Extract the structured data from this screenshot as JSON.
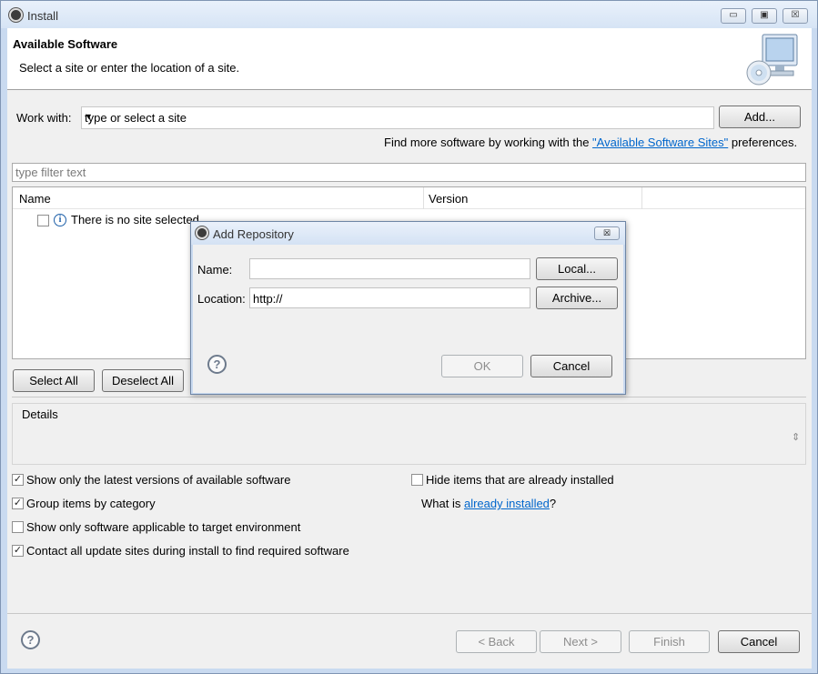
{
  "window": {
    "title": "Install"
  },
  "header": {
    "title": "Available Software",
    "description": "Select a site or enter the location of a site."
  },
  "work_with": {
    "label": "Work with:",
    "value": "type or select a site",
    "add_label": "Add..."
  },
  "more_software": {
    "prefix": "Find more software by working with the ",
    "link": "\"Available Software Sites\"",
    "suffix": " preferences."
  },
  "filter": {
    "placeholder": "type filter text"
  },
  "table": {
    "columns": [
      "Name",
      "Version"
    ],
    "rows": [
      {
        "label": "There is no site selected."
      }
    ]
  },
  "selection_buttons": {
    "select_all": "Select All",
    "deselect_all": "Deselect All"
  },
  "details": {
    "label": "Details"
  },
  "options": {
    "left": [
      {
        "label": "Show only the latest versions of available software",
        "checked": true
      },
      {
        "label": "Group items by category",
        "checked": true
      },
      {
        "label": "Show only software applicable to target environment",
        "checked": false
      },
      {
        "label": "Contact all update sites during install to find required software",
        "checked": true
      }
    ],
    "hide_installed": {
      "label": "Hide items that are already installed",
      "checked": false
    },
    "what_is": {
      "prefix": "What is ",
      "link": "already installed",
      "suffix": "?"
    }
  },
  "footer": {
    "back": "< Back",
    "next": "Next >",
    "finish": "Finish",
    "cancel": "Cancel"
  },
  "dialog": {
    "title": "Add Repository",
    "name_label": "Name:",
    "name_value": "",
    "location_label": "Location:",
    "location_value": "http://",
    "local_label": "Local...",
    "archive_label": "Archive...",
    "ok_label": "OK",
    "cancel_label": "Cancel"
  },
  "check_mark": "✓",
  "icons": {
    "help": "?",
    "info": "i",
    "minimize": "▭",
    "maximize": "▣",
    "close": "☒",
    "dropdown": "▼",
    "scroll": "⇕"
  }
}
